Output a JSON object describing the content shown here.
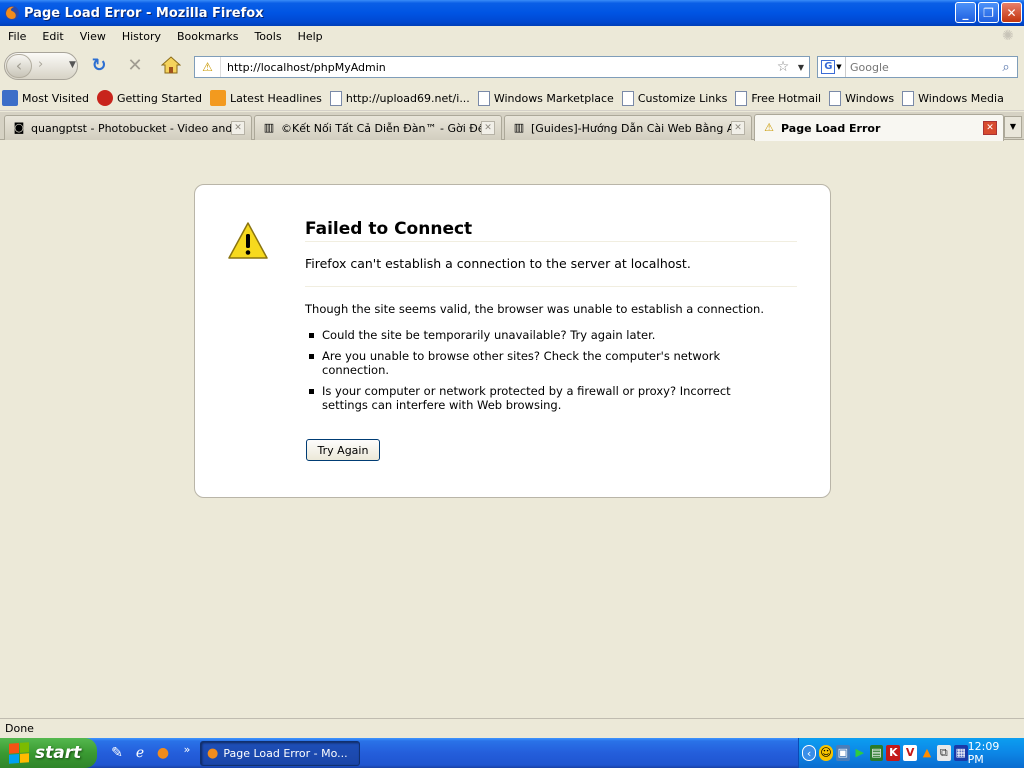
{
  "window": {
    "title": "Page Load Error - Mozilla Firefox",
    "minimize": "_",
    "restore": "❐",
    "close": "✕"
  },
  "menu": {
    "items": [
      "File",
      "Edit",
      "View",
      "History",
      "Bookmarks",
      "Tools",
      "Help"
    ]
  },
  "navbar": {
    "url": "http://localhost/phpMyAdmin",
    "search_placeholder": "Google"
  },
  "bookmarks": [
    {
      "label": "Most Visited",
      "icon": "most-visited-icon"
    },
    {
      "label": "Getting Started",
      "icon": "firefox-bookmark-icon"
    },
    {
      "label": "Latest Headlines",
      "icon": "rss-feed-icon"
    },
    {
      "label": "http://upload69.net/i...",
      "icon": "page-icon"
    },
    {
      "label": "Windows Marketplace",
      "icon": "page-icon"
    },
    {
      "label": "Customize Links",
      "icon": "page-icon"
    },
    {
      "label": "Free Hotmail",
      "icon": "page-icon"
    },
    {
      "label": "Windows",
      "icon": "page-icon"
    },
    {
      "label": "Windows Media",
      "icon": "page-icon"
    }
  ],
  "tabs": [
    {
      "label": "quangptst - Photobucket - Video and I..."
    },
    {
      "label": "©Kết Nối Tất Cả Diễn Đàn™ - Gời Đề T..."
    },
    {
      "label": "[Guides]-Hướng Dẫn Cài Web Bằng Ap..."
    },
    {
      "label": "Page Load Error"
    }
  ],
  "error": {
    "title": "Failed to Connect",
    "subtitle": "Firefox can't establish a connection to the server at localhost.",
    "description": "Though the site seems valid, the browser was unable to establish a connection.",
    "bullets": [
      "Could the site be temporarily unavailable? Try again later.",
      "Are you unable to browse other sites? Check the computer's network connection.",
      "Is your computer or network protected by a firewall or proxy? Incorrect settings can interfere with Web browsing."
    ],
    "button": "Try Again"
  },
  "status": {
    "text": "Done"
  },
  "taskbar": {
    "start": "start",
    "quicklaunch_more": "»",
    "active_task": "Page Load Error - Mo...",
    "clock": "12:09 PM",
    "tray_expand": "‹"
  }
}
